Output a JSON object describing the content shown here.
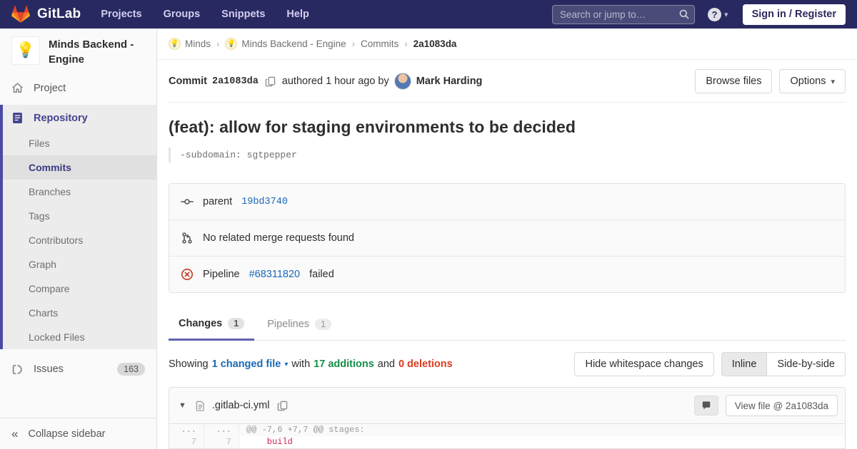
{
  "colors": {
    "navbar_bg": "#292961",
    "accent_indigo": "#4b4ba3",
    "link_blue": "#1b69b6",
    "additions_green": "#168f48",
    "deletions_red": "#db3b21",
    "pipeline_failed_red": "#c0341d"
  },
  "icons": {
    "breadcrumb_separator": "›",
    "caret_down": "▾",
    "expand_caret": "▼",
    "collapse_chevrons": "«",
    "help_glyph": "?",
    "project_avatar_emoji": "💡",
    "breadcrumb_avatar_emoji": "💡"
  },
  "navbar": {
    "brand": "GitLab",
    "menu": [
      {
        "label": "Projects"
      },
      {
        "label": "Groups"
      },
      {
        "label": "Snippets"
      },
      {
        "label": "Help"
      }
    ],
    "search_placeholder": "Search or jump to…",
    "sign_in": "Sign in / Register"
  },
  "sidebar": {
    "project_title": "Minds Backend - Engine",
    "project_item": "Project",
    "repository_item": "Repository",
    "repo_children": [
      {
        "label": "Files"
      },
      {
        "label": "Commits"
      },
      {
        "label": "Branches"
      },
      {
        "label": "Tags"
      },
      {
        "label": "Contributors"
      },
      {
        "label": "Graph"
      },
      {
        "label": "Compare"
      },
      {
        "label": "Charts"
      },
      {
        "label": "Locked Files"
      }
    ],
    "issues_label": "Issues",
    "issues_count": "163",
    "collapse_label": "Collapse sidebar"
  },
  "breadcrumb": {
    "items": [
      {
        "label": "Minds"
      },
      {
        "label": "Minds Backend - Engine"
      },
      {
        "label": "Commits"
      },
      {
        "label": "2a1083da"
      }
    ]
  },
  "commit": {
    "label": "Commit",
    "sha": "2a1083da",
    "authored": "authored 1 hour ago by",
    "author": "Mark Harding",
    "browse_files": "Browse files",
    "options": "Options",
    "title": "(feat): allow for staging environments to be decided",
    "description": "-subdomain: sgtpepper",
    "parent_label": "parent",
    "parent_sha": "19bd3740",
    "merge_requests_text": "No related merge requests found",
    "pipeline_label": "Pipeline",
    "pipeline_id": "#68311820",
    "pipeline_status": "failed"
  },
  "tabs": [
    {
      "label": "Changes",
      "count": "1"
    },
    {
      "label": "Pipelines",
      "count": "1"
    }
  ],
  "changes_bar": {
    "showing": "Showing",
    "changed_files": "1 changed file",
    "with_word": "with",
    "additions": "17 additions",
    "and_word": "and",
    "deletions": "0 deletions",
    "hide_whitespace": "Hide whitespace changes",
    "inline": "Inline",
    "side_by_side": "Side-by-side"
  },
  "diff": {
    "file_name": ".gitlab-ci.yml",
    "view_file": "View file @ 2a1083da",
    "rows": [
      {
        "old": "...",
        "new": "...",
        "code": "@@ -7,6 +7,7 @@ stages:"
      },
      {
        "old": "7",
        "new": "7",
        "code": "    build"
      }
    ]
  }
}
